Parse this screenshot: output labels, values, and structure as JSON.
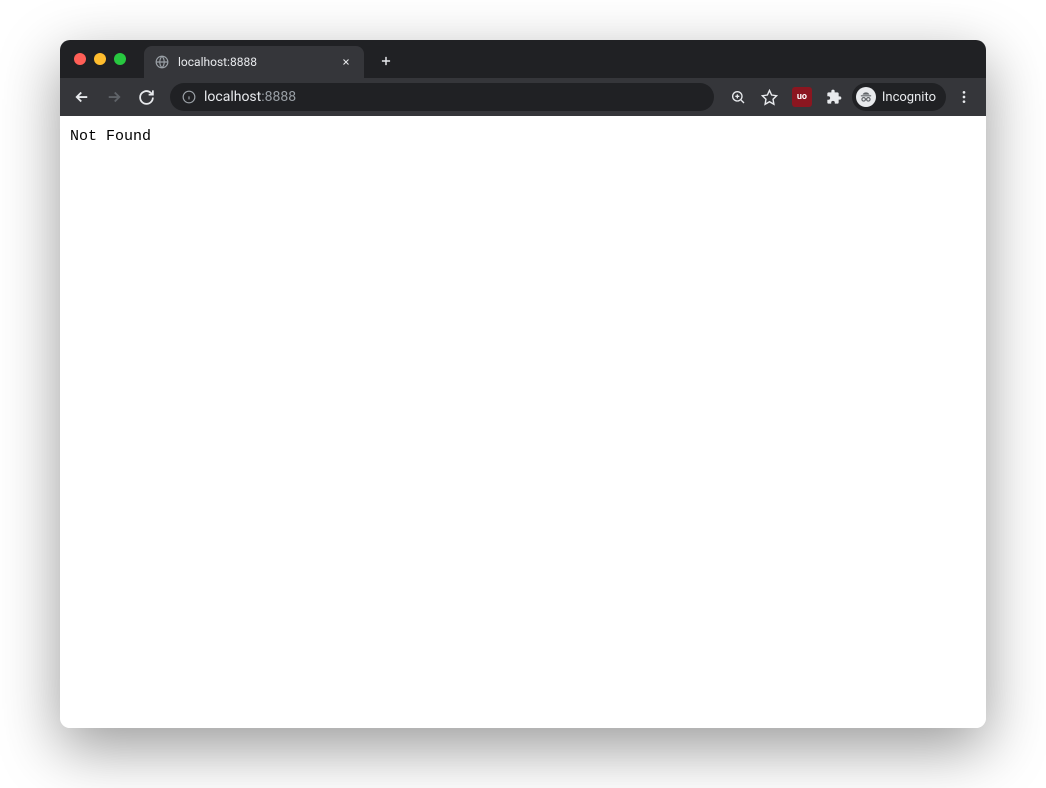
{
  "tab": {
    "title": "localhost:8888"
  },
  "omnibox": {
    "domain": "localhost",
    "port": ":8888"
  },
  "toolbar": {
    "incognito_label": "Incognito",
    "extension_label": "uo"
  },
  "page": {
    "body_text": "Not Found"
  }
}
